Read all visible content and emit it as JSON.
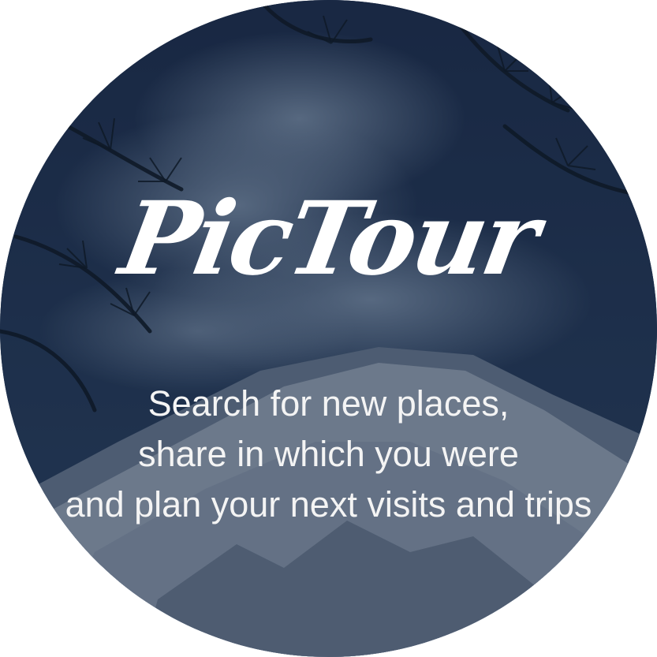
{
  "app": {
    "logo_text": "PicTour"
  },
  "tagline": {
    "line1": "Search for new places,",
    "line2": "share in which you were",
    "line3": "and plan your next visits and trips"
  }
}
